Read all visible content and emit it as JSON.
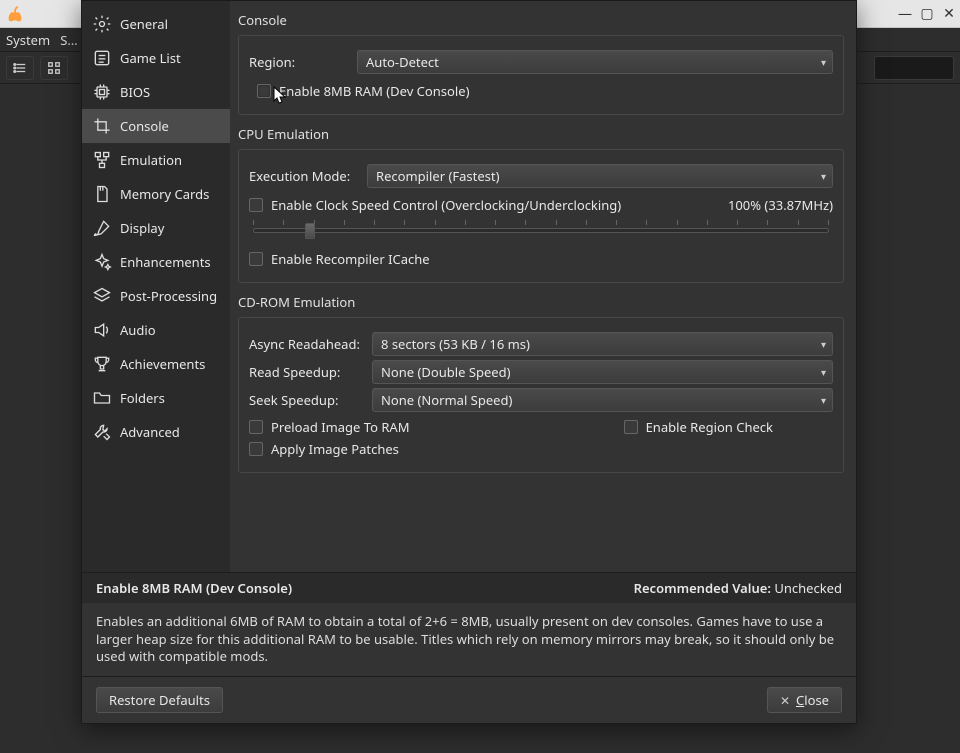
{
  "mainwin": {
    "menu": {
      "system": "System",
      "settings": "S…"
    }
  },
  "sidebar": {
    "items": [
      {
        "label": "General"
      },
      {
        "label": "Game List"
      },
      {
        "label": "BIOS"
      },
      {
        "label": "Console"
      },
      {
        "label": "Emulation"
      },
      {
        "label": "Memory Cards"
      },
      {
        "label": "Display"
      },
      {
        "label": "Enhancements"
      },
      {
        "label": "Post-Processing"
      },
      {
        "label": "Audio"
      },
      {
        "label": "Achievements"
      },
      {
        "label": "Folders"
      },
      {
        "label": "Advanced"
      }
    ],
    "selected_index": 3
  },
  "console": {
    "title": "Console",
    "region_label": "Region:",
    "region_value": "Auto-Detect",
    "enable_8mb": "Enable 8MB RAM (Dev Console)"
  },
  "cpu": {
    "title": "CPU Emulation",
    "exec_label": "Execution Mode:",
    "exec_value": "Recompiler (Fastest)",
    "clock_ctl": "Enable Clock Speed Control (Overclocking/Underclocking)",
    "clock_value": "100% (33.87MHz)",
    "icache": "Enable Recompiler ICache"
  },
  "cdrom": {
    "title": "CD-ROM Emulation",
    "async_label": "Async Readahead:",
    "async_value": "8 sectors (53 KB / 16 ms)",
    "read_label": "Read Speedup:",
    "read_value": "None (Double Speed)",
    "seek_label": "Seek Speedup:",
    "seek_value": "None (Normal Speed)",
    "preload": "Preload Image To RAM",
    "region_check": "Enable Region Check",
    "patches": "Apply Image Patches"
  },
  "help": {
    "heading": "Enable 8MB RAM (Dev Console)",
    "rec_label": "Recommended Value:",
    "rec_value": " Unchecked",
    "body": "Enables an additional 6MB of RAM to obtain a total of 2+6 = 8MB, usually present on dev consoles. Games have to use a larger heap size for this additional RAM to be usable. Titles which rely on memory mirrors may break, so it should only be used with compatible mods."
  },
  "footer": {
    "restore": "Restore Defaults",
    "close_prefix": "C",
    "close_rest": "lose"
  }
}
